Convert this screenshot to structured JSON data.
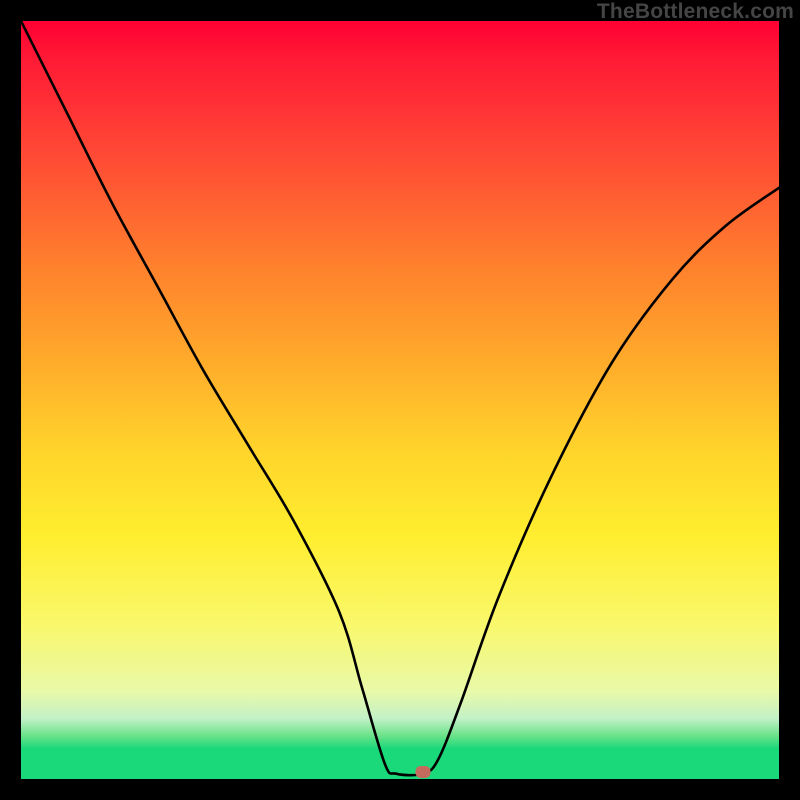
{
  "watermark": "TheBottleneck.com",
  "chart_data": {
    "type": "line",
    "title": "",
    "xlabel": "",
    "ylabel": "",
    "xlim": [
      0,
      100
    ],
    "ylim": [
      0,
      100
    ],
    "grid": false,
    "series": [
      {
        "name": "bottleneck-curve",
        "x": [
          0,
          6,
          12,
          18,
          24,
          30,
          36,
          42,
          45,
          48,
          49.5,
          53,
          55,
          58,
          63,
          70,
          78,
          86,
          93,
          100
        ],
        "y": [
          100,
          88,
          76,
          65,
          54,
          44,
          34,
          22,
          12,
          2,
          0.7,
          0.7,
          2.5,
          10,
          24,
          40,
          55,
          66,
          73,
          78
        ]
      }
    ],
    "marker": {
      "x": 53,
      "y": 0.9,
      "color": "#c46b5e"
    },
    "background_gradient": {
      "from": "#ff0033",
      "to": "#1ad97a",
      "stops": [
        {
          "pos": 0.0,
          "color": "#ff0033"
        },
        {
          "pos": 0.32,
          "color": "#ff7f2d"
        },
        {
          "pos": 0.57,
          "color": "#ffd52b"
        },
        {
          "pos": 0.8,
          "color": "#f9f86e"
        },
        {
          "pos": 0.92,
          "color": "#c3f1c7"
        },
        {
          "pos": 0.96,
          "color": "#1ad97a"
        }
      ]
    }
  }
}
